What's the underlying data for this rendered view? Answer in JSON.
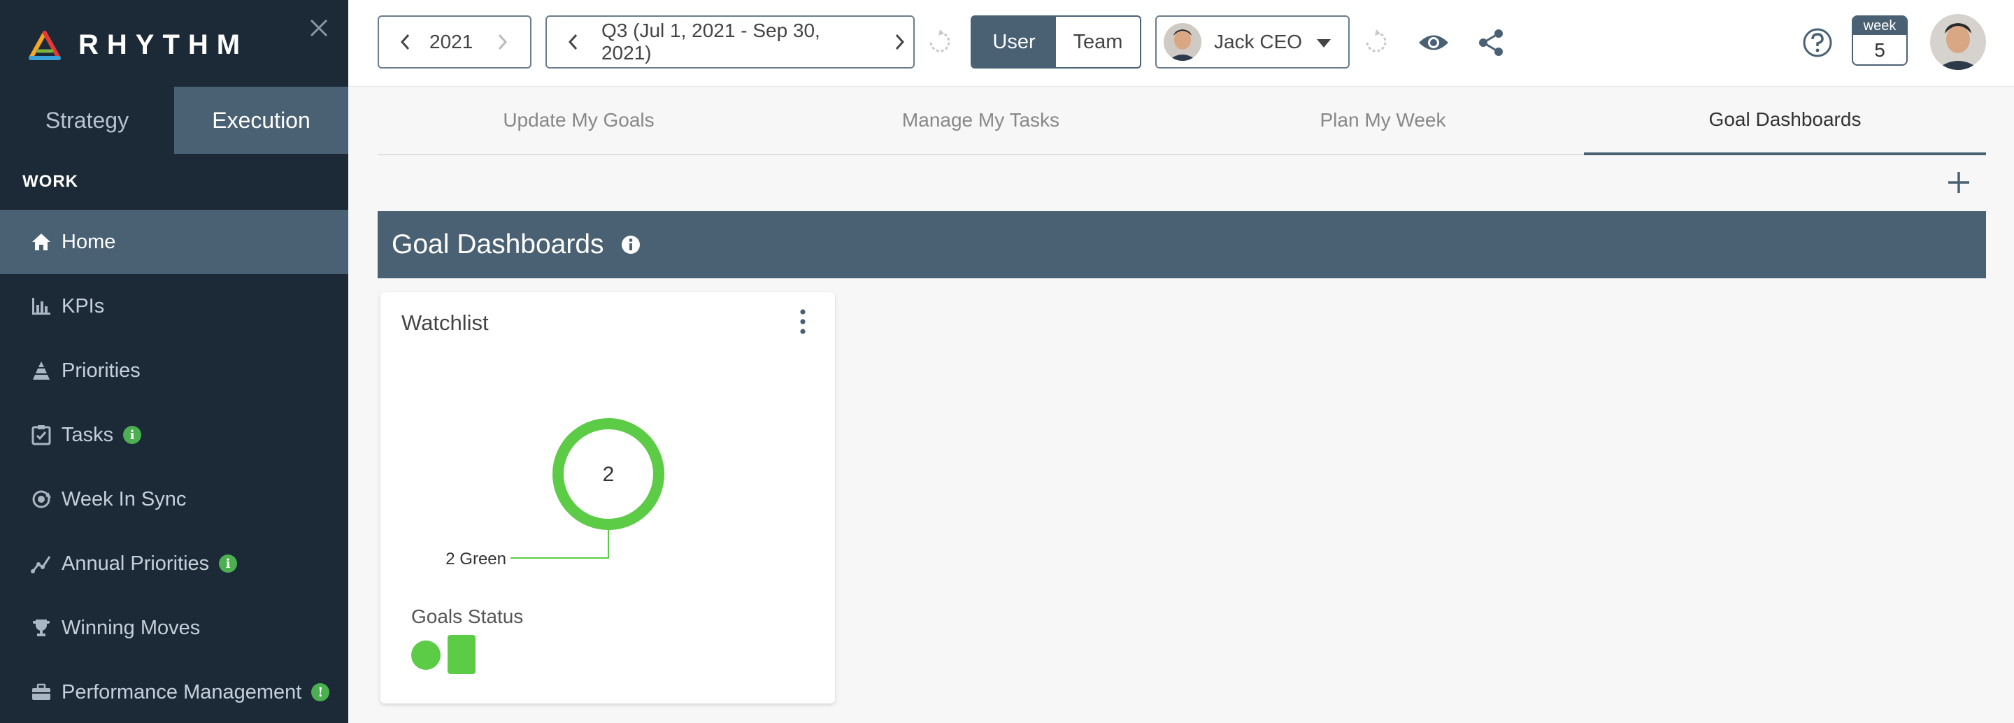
{
  "app": {
    "logo_text": "RHYTHM",
    "accent_color": "#4a6073",
    "status_green": "#5ccb45"
  },
  "sidebar": {
    "mode_tabs": [
      {
        "label": "Strategy",
        "active": false
      },
      {
        "label": "Execution",
        "active": true
      }
    ],
    "section_title": "WORK",
    "items": [
      {
        "label": "Home",
        "icon": "home-icon",
        "active": true
      },
      {
        "label": "KPIs",
        "icon": "kpi-chart-icon"
      },
      {
        "label": "Priorities",
        "icon": "priorities-pyramid-icon"
      },
      {
        "label": "Tasks",
        "icon": "tasks-checkbox-icon",
        "badge": "i"
      },
      {
        "label": "Week In Sync",
        "icon": "sync-icon"
      },
      {
        "label": "Annual Priorities",
        "icon": "trend-icon",
        "badge": "i"
      },
      {
        "label": "Winning Moves",
        "icon": "trophy-icon"
      },
      {
        "label": "Performance Management",
        "icon": "briefcase-icon",
        "badge": "!"
      }
    ]
  },
  "topbar": {
    "year": "2021",
    "period": "Q3 (Jul 1, 2021 - Sep 30, 2021)",
    "segment": [
      {
        "label": "User",
        "active": true
      },
      {
        "label": "Team",
        "active": false
      }
    ],
    "user_name": "Jack CEO",
    "week_label": "week",
    "week_number": "5"
  },
  "page_tabs": [
    {
      "label": "Update My Goals",
      "active": false
    },
    {
      "label": "Manage My Tasks",
      "active": false
    },
    {
      "label": "Plan My Week",
      "active": false
    },
    {
      "label": "Goal Dashboards",
      "active": true
    }
  ],
  "dashboard": {
    "title": "Goal Dashboards",
    "card": {
      "title": "Watchlist",
      "donut_total": "2",
      "callout": "2 Green",
      "legend_title": "Goals Status"
    }
  },
  "chart_data": {
    "type": "pie",
    "categories": [
      "Green"
    ],
    "values": [
      2
    ],
    "title": "",
    "center_label": "2"
  }
}
